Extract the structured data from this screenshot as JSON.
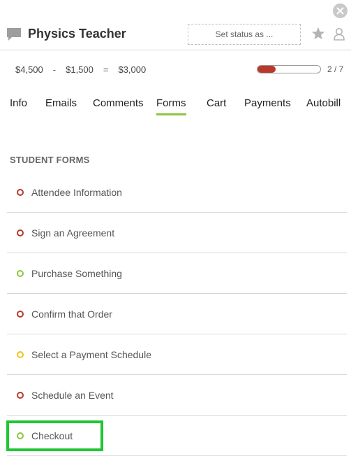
{
  "header": {
    "title": "Physics Teacher",
    "status_placeholder": "Set status as ...",
    "icons": [
      "chat-bubble-icon",
      "star-icon",
      "user-icon",
      "close-icon"
    ]
  },
  "amounts": {
    "total": "$4,500",
    "minus": "-",
    "paid": "$1,500",
    "equals": "=",
    "balance": "$3,000"
  },
  "progress": {
    "text": "2 / 7",
    "completed": 2,
    "total": 7,
    "fill_color": "#b8392b"
  },
  "tabs": [
    {
      "label": "Info",
      "active": false
    },
    {
      "label": "Emails",
      "active": false
    },
    {
      "label": "Comments",
      "active": false
    },
    {
      "label": "Forms",
      "active": true
    },
    {
      "label": "Cart",
      "active": false
    },
    {
      "label": "Payments",
      "active": false
    },
    {
      "label": "Autobill",
      "active": false
    }
  ],
  "section_title": "STUDENT FORMS",
  "forms": [
    {
      "label": "Attendee Information",
      "status_color": "#b8392b"
    },
    {
      "label": "Sign an Agreement",
      "status_color": "#b8392b"
    },
    {
      "label": "Purchase Something",
      "status_color": "#8dc63f"
    },
    {
      "label": "Confirm that Order",
      "status_color": "#b8392b"
    },
    {
      "label": "Select a Payment Schedule",
      "status_color": "#f2c31a"
    },
    {
      "label": "Schedule an Event",
      "status_color": "#b8392b"
    },
    {
      "label": "Checkout",
      "status_color": "#8dc63f"
    }
  ],
  "colors": {
    "accent_green": "#8dc63f",
    "highlight": "#21c634",
    "incomplete_red": "#b8392b",
    "pending_yellow": "#f2c31a"
  }
}
